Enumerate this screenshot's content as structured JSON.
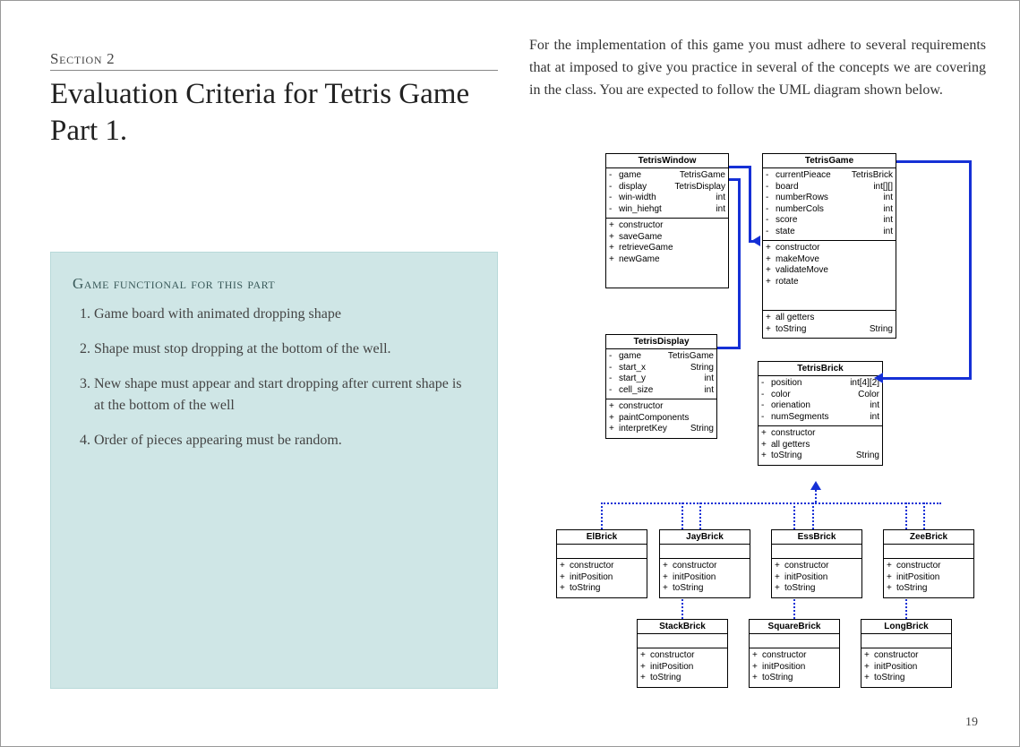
{
  "section_label": "Section 2",
  "title": "Evaluation Criteria for Tetris Game Part 1.",
  "panel": {
    "heading": "Game functional for this part",
    "items": [
      "Game board with animated dropping shape",
      "Shape must stop dropping at the bottom of the well.",
      "New shape must appear and start dropping after current shape is at the bottom of the well",
      " Order of pieces appearing must be random."
    ]
  },
  "intro_para": "For the implementation of this game you must adhere to several requirements that at imposed to give you practice in several of the concepts we are covering in the class.  You are expected to follow the UML diagram shown below.",
  "page_number": "19",
  "uml": {
    "TetrisWindow": {
      "name": "TetrisWindow",
      "attrs": [
        {
          "vis": "-",
          "name": "game",
          "type": "TetrisGame"
        },
        {
          "vis": "-",
          "name": "display",
          "type": "TetrisDisplay"
        },
        {
          "vis": "-",
          "name": "win-width",
          "type": "int"
        },
        {
          "vis": "-",
          "name": "win_hiehgt",
          "type": "int"
        }
      ],
      "meths": [
        {
          "vis": "+",
          "name": "constructor",
          "type": ""
        },
        {
          "vis": "+",
          "name": "saveGame",
          "type": ""
        },
        {
          "vis": "+",
          "name": "retrieveGame",
          "type": ""
        },
        {
          "vis": "+",
          "name": "newGame",
          "type": ""
        }
      ]
    },
    "TetrisGame": {
      "name": "TetrisGame",
      "attrs": [
        {
          "vis": "-",
          "name": "currentPieace",
          "type": "TetrisBrick"
        },
        {
          "vis": "-",
          "name": "board",
          "type": "int[][]"
        },
        {
          "vis": "-",
          "name": "numberRows",
          "type": "int"
        },
        {
          "vis": "-",
          "name": "numberCols",
          "type": "int"
        },
        {
          "vis": "-",
          "name": "score",
          "type": "int"
        },
        {
          "vis": "-",
          "name": "state",
          "type": "int"
        }
      ],
      "meths1": [
        {
          "vis": "+",
          "name": "constructor",
          "type": ""
        },
        {
          "vis": "+",
          "name": "makeMove",
          "type": ""
        },
        {
          "vis": "+",
          "name": "validateMove",
          "type": ""
        },
        {
          "vis": "+",
          "name": "rotate",
          "type": ""
        }
      ],
      "meths2": [
        {
          "vis": "+",
          "name": "all getters",
          "type": ""
        },
        {
          "vis": "+",
          "name": "toString",
          "type": "String"
        }
      ]
    },
    "TetrisDisplay": {
      "name": "TetrisDisplay",
      "attrs": [
        {
          "vis": "-",
          "name": "game",
          "type": "TetrisGame"
        },
        {
          "vis": "-",
          "name": "start_x",
          "type": "String"
        },
        {
          "vis": "-",
          "name": "start_y",
          "type": "int"
        },
        {
          "vis": "-",
          "name": "cell_size",
          "type": "int"
        }
      ],
      "meths": [
        {
          "vis": "+",
          "name": "constructor",
          "type": ""
        },
        {
          "vis": "+",
          "name": "paintComponents",
          "type": ""
        },
        {
          "vis": "+",
          "name": "interpretKey",
          "type": "String"
        }
      ]
    },
    "TetrisBrick": {
      "name": "TetrisBrick",
      "attrs": [
        {
          "vis": "-",
          "name": "position",
          "type": "int[4][2]"
        },
        {
          "vis": "-",
          "name": "color",
          "type": "Color"
        },
        {
          "vis": "-",
          "name": "orienation",
          "type": "int"
        },
        {
          "vis": "-",
          "name": "numSegments",
          "type": "int"
        }
      ],
      "meths": [
        {
          "vis": "+",
          "name": "constructor",
          "type": ""
        },
        {
          "vis": "+",
          "name": "all getters",
          "type": ""
        },
        {
          "vis": "+",
          "name": "toString",
          "type": "String"
        }
      ]
    },
    "sub_row1": [
      {
        "name": "ElBrick",
        "meths": [
          {
            "vis": "+",
            "name": "constructor"
          },
          {
            "vis": "+",
            "name": "initPosition"
          },
          {
            "vis": "+",
            "name": "toString"
          }
        ]
      },
      {
        "name": "JayBrick",
        "meths": [
          {
            "vis": "+",
            "name": "constructor"
          },
          {
            "vis": "+",
            "name": "initPosition"
          },
          {
            "vis": "+",
            "name": "toString"
          }
        ]
      },
      {
        "name": "EssBrick",
        "meths": [
          {
            "vis": "+",
            "name": "constructor"
          },
          {
            "vis": "+",
            "name": "initPosition"
          },
          {
            "vis": "+",
            "name": "toString"
          }
        ]
      },
      {
        "name": "ZeeBrick",
        "meths": [
          {
            "vis": "+",
            "name": "constructor"
          },
          {
            "vis": "+",
            "name": "initPosition"
          },
          {
            "vis": "+",
            "name": "toString"
          }
        ]
      }
    ],
    "sub_row2": [
      {
        "name": "StackBrick",
        "meths": [
          {
            "vis": "+",
            "name": "constructor"
          },
          {
            "vis": "+",
            "name": "initPosition"
          },
          {
            "vis": "+",
            "name": "toString"
          }
        ]
      },
      {
        "name": "SquareBrick",
        "meths": [
          {
            "vis": "+",
            "name": "constructor"
          },
          {
            "vis": "+",
            "name": "initPosition"
          },
          {
            "vis": "+",
            "name": "toString"
          }
        ]
      },
      {
        "name": "LongBrick",
        "meths": [
          {
            "vis": "+",
            "name": "constructor"
          },
          {
            "vis": "+",
            "name": "initPosition"
          },
          {
            "vis": "+",
            "name": "toString"
          }
        ]
      }
    ]
  }
}
